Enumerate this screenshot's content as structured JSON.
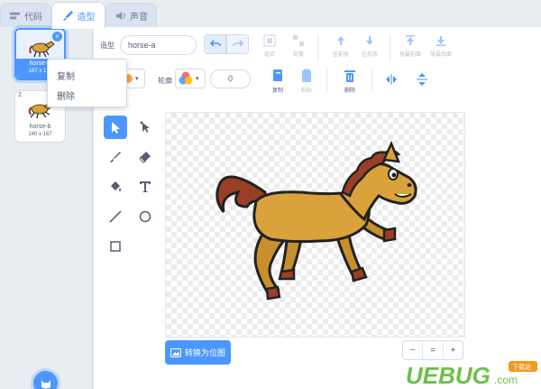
{
  "tabs": [
    {
      "label": "代码",
      "icon": "code-icon"
    },
    {
      "label": "造型",
      "icon": "brush-icon"
    },
    {
      "label": "声音",
      "icon": "speaker-icon"
    }
  ],
  "costumes": [
    {
      "index": "1",
      "name": "horse-a",
      "size": "187 x 1…",
      "selected": true
    },
    {
      "index": "2",
      "name": "horse-b",
      "size": "140 x 167",
      "selected": false
    }
  ],
  "context_menu": [
    "复制",
    "删除"
  ],
  "editor": {
    "costume_label": "造型",
    "costume_name": "horse-a",
    "fill_label": "填充",
    "outline_label": "轮廓",
    "outline_width": "0",
    "toolbar": [
      "组合",
      "拆散",
      "往前放",
      "往后放",
      "放最前面",
      "放最后面"
    ],
    "actions": [
      "复制",
      "粘贴",
      "删除"
    ],
    "convert_label": "转换为位图",
    "zoom": [
      "−",
      "=",
      "+"
    ]
  },
  "tools": [
    "select-tool",
    "reshape-tool",
    "brush-tool",
    "eraser-tool",
    "fill-tool",
    "text-tool",
    "line-tool",
    "circle-tool",
    "rectangle-tool"
  ],
  "watermark": {
    "brand": "UEBUG",
    "suffix": ".com",
    "badge": "下载站"
  },
  "colors": {
    "accent": "#4c97ff",
    "horse_body": "#d9a23a",
    "mane": "#9a3f26"
  }
}
